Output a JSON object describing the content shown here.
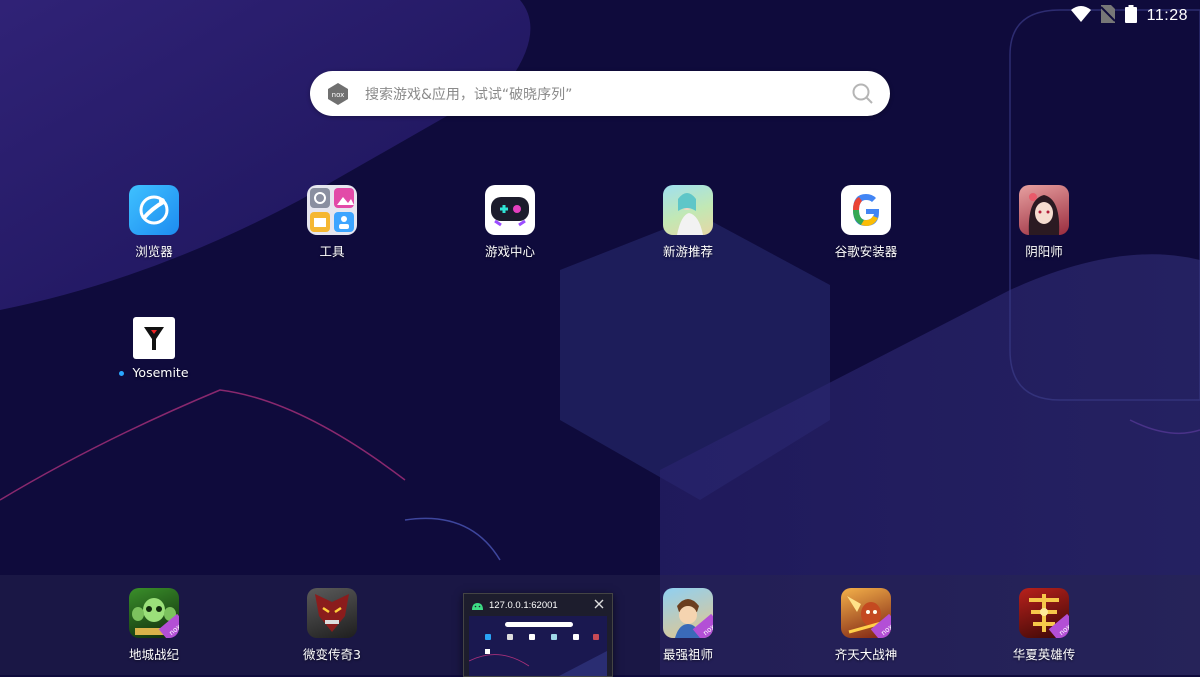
{
  "status_bar": {
    "time": "11:28",
    "icons": [
      "wifi-icon",
      "no-sim-icon",
      "battery-icon"
    ]
  },
  "search": {
    "placeholder": "搜索游戏&应用，试试“破晓序列”",
    "logo_text": "nox"
  },
  "desktop_apps": [
    {
      "label": "浏览器",
      "icon": "browser-icon",
      "color": "#29a3f5"
    },
    {
      "label": "工具",
      "icon": "tools-folder-icon",
      "color": "#d9d9e6"
    },
    {
      "label": "游戏中心",
      "icon": "game-center-icon",
      "color": "#ffffff"
    },
    {
      "label": "新游推荐",
      "icon": "new-games-icon",
      "color": "#7fc4d9"
    },
    {
      "label": "谷歌安装器",
      "icon": "google-installer-icon",
      "color": "#ffffff"
    },
    {
      "label": "阴阳师",
      "icon": "onmyoji-icon",
      "color": "#c84a55"
    },
    {
      "label": "Yosemite",
      "icon": "yosemite-icon",
      "color": "#ffffff",
      "new_dot": true
    }
  ],
  "dock_apps": [
    {
      "label": "地城战纪",
      "icon": "dungeon-game-icon",
      "badge": "nox"
    },
    {
      "label": "微变传奇3",
      "icon": "legend3-game-icon"
    },
    {
      "label": "最强祖师",
      "icon": "strongest-master-icon",
      "badge": "nox"
    },
    {
      "label": "齐天大战神",
      "icon": "monkey-king-icon",
      "badge": "nox"
    },
    {
      "label": "华夏英雄传",
      "icon": "huaxia-hero-icon",
      "badge": "nox"
    }
  ],
  "task_window": {
    "title": "127.0.0.1:62001"
  },
  "colors": {
    "background": "#0f0b3c",
    "dock": "#28265a",
    "accent_dot": "#29a7ff"
  }
}
